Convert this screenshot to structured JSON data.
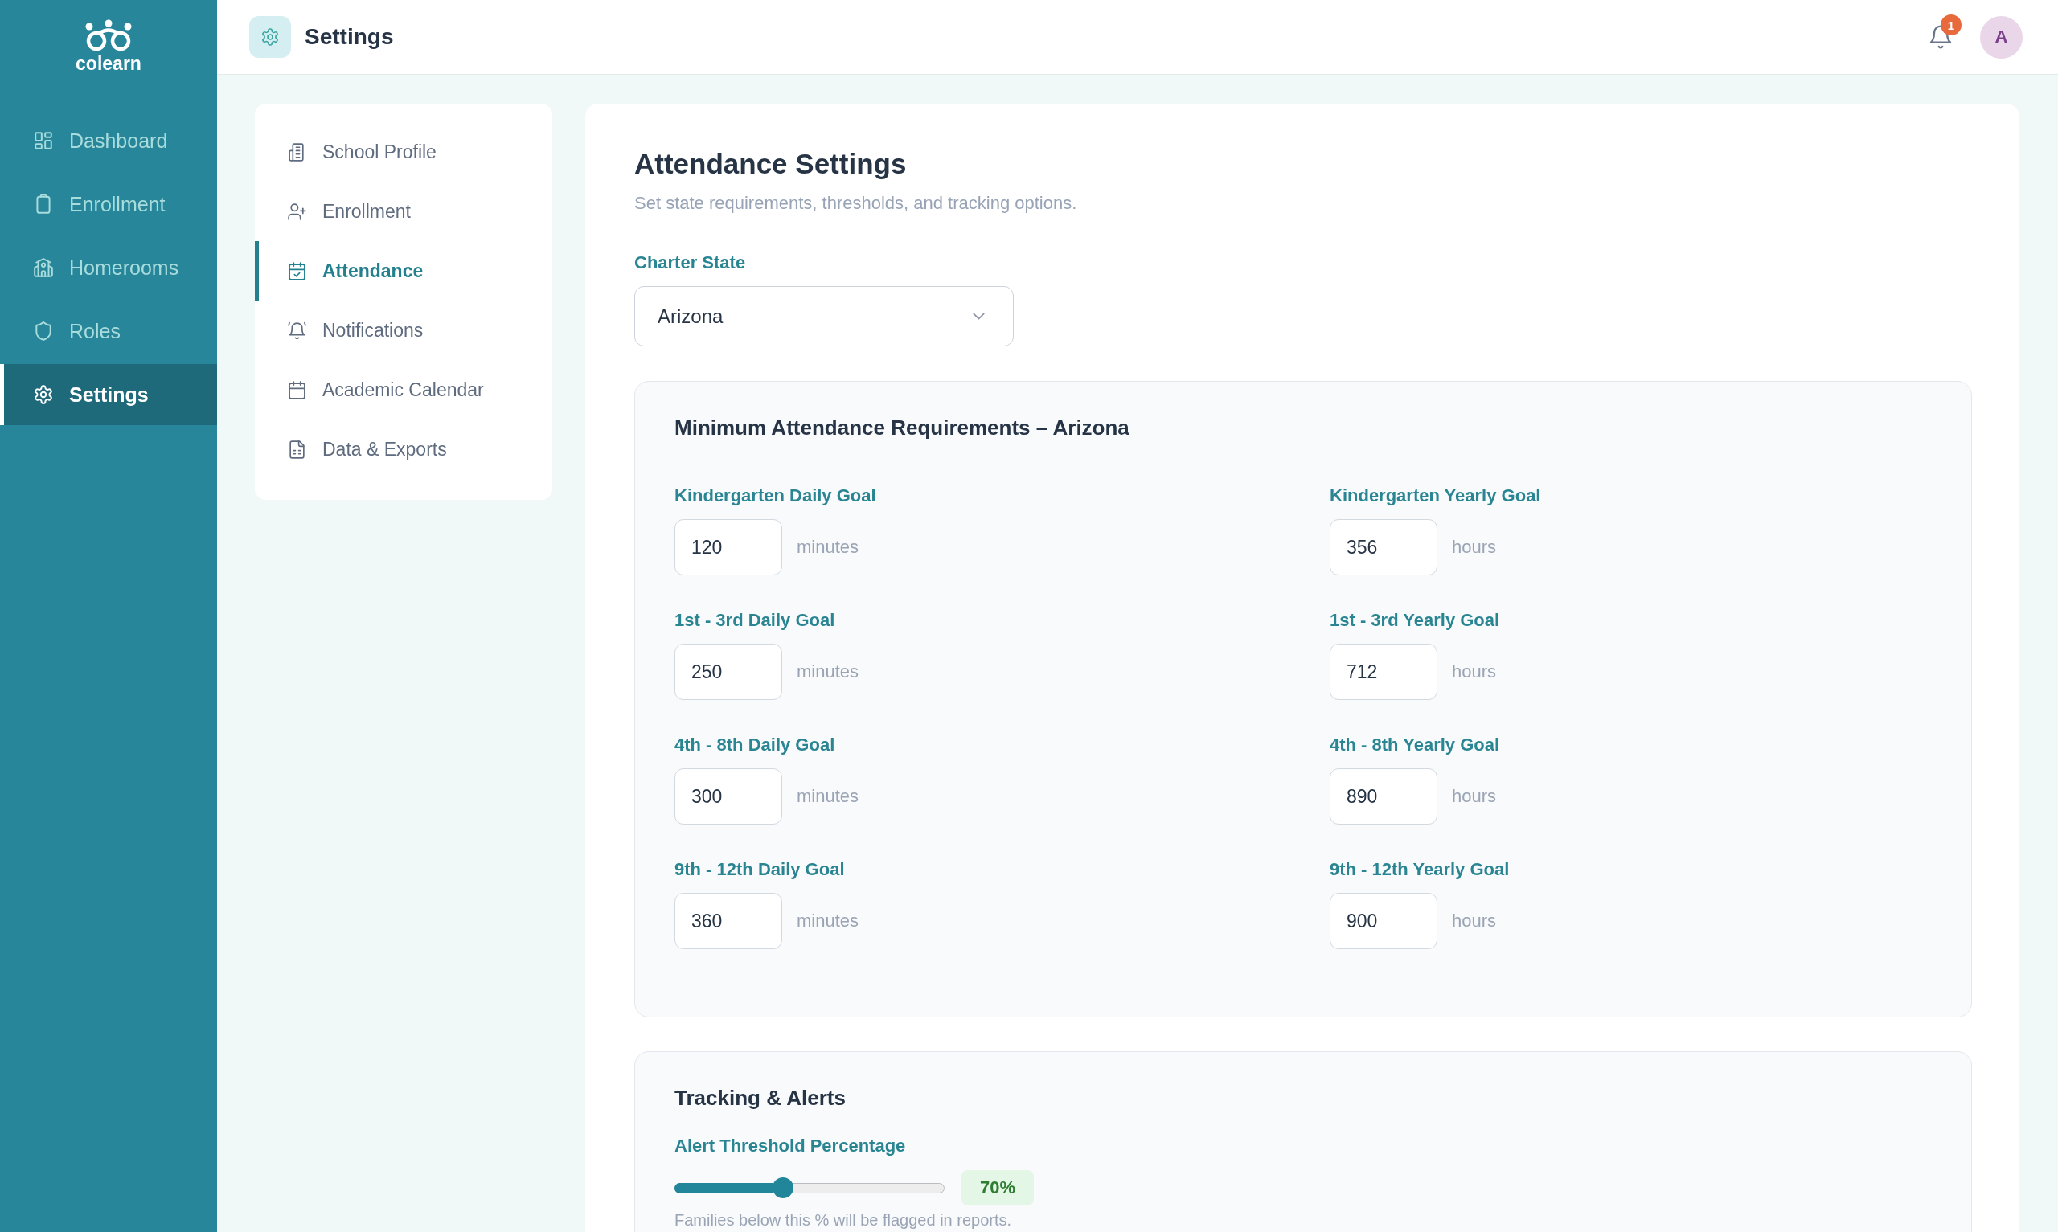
{
  "sidebar": {
    "logo": "colearn",
    "items": [
      {
        "label": "Dashboard",
        "selected": false
      },
      {
        "label": "Enrollment",
        "selected": false
      },
      {
        "label": "Homerooms",
        "selected": false
      },
      {
        "label": "Roles",
        "selected": false
      },
      {
        "label": "Settings",
        "selected": true
      }
    ]
  },
  "header": {
    "title": "Settings",
    "notification_count": "1",
    "avatar": "A"
  },
  "settings_nav": {
    "items": [
      {
        "label": "School Profile",
        "selected": false
      },
      {
        "label": "Enrollment",
        "selected": false
      },
      {
        "label": "Attendance",
        "selected": true
      },
      {
        "label": "Notifications",
        "selected": false
      },
      {
        "label": "Academic Calendar",
        "selected": false
      },
      {
        "label": "Data & Exports",
        "selected": false
      }
    ]
  },
  "attendance": {
    "title": "Attendance Settings",
    "subtitle": "Set state requirements, thresholds, and tracking options.",
    "charter_state": {
      "label": "Charter State",
      "value": "Arizona"
    },
    "requirements": {
      "title": "Minimum Attendance Requirements – Arizona",
      "goals": [
        {
          "label": "Kindergarten Daily Goal",
          "value": "120",
          "unit": "minutes"
        },
        {
          "label": "Kindergarten Yearly Goal",
          "value": "356",
          "unit": "hours"
        },
        {
          "label": "1st - 3rd Daily Goal",
          "value": "250",
          "unit": "minutes"
        },
        {
          "label": "1st - 3rd Yearly Goal",
          "value": "712",
          "unit": "hours"
        },
        {
          "label": "4th - 8th Daily Goal",
          "value": "300",
          "unit": "minutes"
        },
        {
          "label": "4th - 8th Yearly Goal",
          "value": "890",
          "unit": "hours"
        },
        {
          "label": "9th - 12th Daily Goal",
          "value": "360",
          "unit": "minutes"
        },
        {
          "label": "9th - 12th Yearly Goal",
          "value": "900",
          "unit": "hours"
        }
      ]
    },
    "tracking": {
      "title": "Tracking & Alerts",
      "threshold": {
        "label": "Alert Threshold Percentage",
        "level": 0.4,
        "reading": "70%",
        "hint": "Families below this % will be flagged in reports."
      }
    }
  }
}
